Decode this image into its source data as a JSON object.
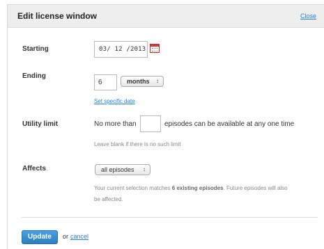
{
  "dialog": {
    "title": "Edit license window",
    "close_label": "Close"
  },
  "starting": {
    "label": "Starting",
    "date_value": "03/ 12 /2013",
    "calendar_icon": "calendar-icon"
  },
  "ending": {
    "label": "Ending",
    "number_value": "6",
    "unit_selected": "months",
    "select_arrows": "↕",
    "specific_date_link": "Set specific date"
  },
  "utility_limit": {
    "label": "Utility limit",
    "prefix_text": "No more than",
    "input_value": "",
    "suffix_text": "episodes can be available at any one time",
    "hint": "Leave blank if there is no such limit"
  },
  "affects": {
    "label": "Affects",
    "selected": "all episodes",
    "note_before": "Your current selection matches ",
    "note_bold": "6 existing episodes",
    "note_after": ". Future episodes will also",
    "note_line2": "be affected."
  },
  "footer": {
    "update_label": "Update",
    "or_text": "or",
    "cancel_label": "cancel"
  },
  "colors": {
    "accent": "#2a7fd4",
    "header_bg": "#eeeeee",
    "button_bg": "#3a8fd4"
  }
}
